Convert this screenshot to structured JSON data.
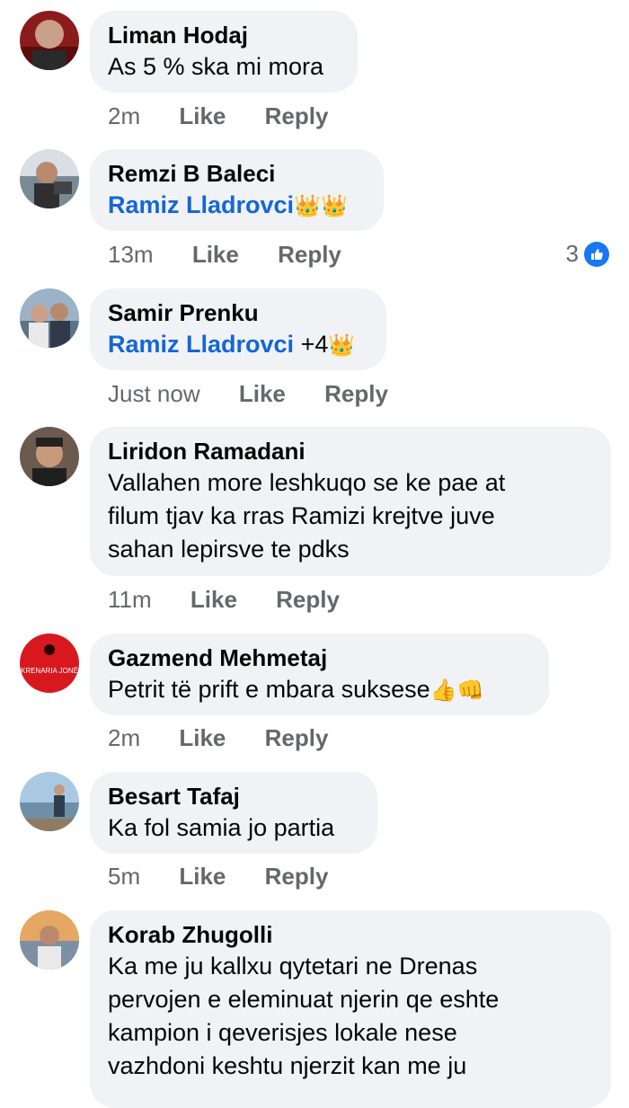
{
  "comments": [
    {
      "author": "Liman Hodaj",
      "text": "As 5 % ska mi mora",
      "time": "2m",
      "like": "Like",
      "reply": "Reply"
    },
    {
      "author": "Remzi B Baleci",
      "mention": "Ramiz Lladrovci",
      "suffix": "",
      "emoji": "👑👑",
      "time": "13m",
      "like": "Like",
      "reply": "Reply",
      "reaction_count": "3"
    },
    {
      "author": "Samir Prenku",
      "mention": "Ramiz Lladrovci",
      "suffix": " +4",
      "emoji": "👑",
      "time": "Just now",
      "like": "Like",
      "reply": "Reply"
    },
    {
      "author": "Liridon Ramadani",
      "lines": [
        "Vallahen more leshkuqo se ke pae at",
        "filum tjav ka rras Ramizi krejtve juve",
        "sahan lepirsve te pdks"
      ],
      "time": "11m",
      "like": "Like",
      "reply": "Reply"
    },
    {
      "author": "Gazmend Mehmetaj",
      "text": "Petrit të prift e mbara suksese",
      "emoji": "👍👊",
      "avatar_text": "KRENARIA JONË",
      "time": "2m",
      "like": "Like",
      "reply": "Reply"
    },
    {
      "author": "Besart Tafaj",
      "text": "Ka fol samia jo partia",
      "time": "5m",
      "like": "Like",
      "reply": "Reply"
    },
    {
      "author": "Korab Zhugolli",
      "lines": [
        "Ka me ju kallxu qytetari ne Drenas",
        "pervojen e eleminuat njerin qe eshte",
        "kampion i qeverisjes lokale nese",
        "vazhdoni keshtu njerzit kan me ju"
      ]
    }
  ],
  "colors": {
    "bubble": "#f0f2f5",
    "mention": "#1566d6",
    "meta": "#65676b",
    "like_badge": "#1877f2"
  }
}
